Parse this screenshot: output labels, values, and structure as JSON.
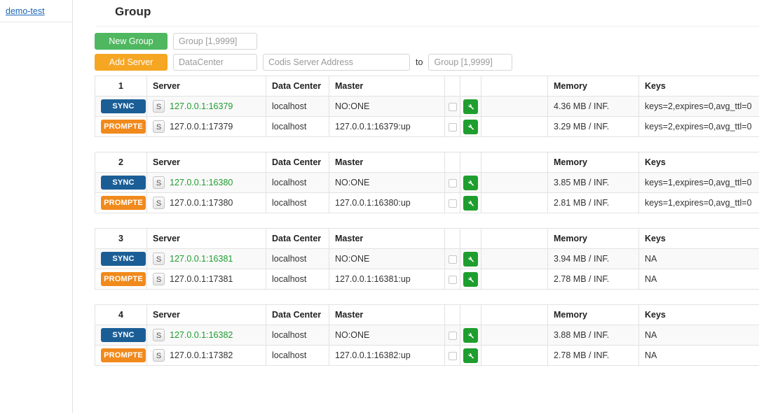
{
  "sidebar": {
    "link_label": "demo-test"
  },
  "header": {
    "title": "Group"
  },
  "toolbar": {
    "new_group_label": "New Group",
    "new_group_placeholder": "Group [1,9999]",
    "new_group_value": "",
    "add_server_label": "Add Server",
    "datacenter_placeholder": "DataCenter",
    "datacenter_value": "",
    "server_address_placeholder": "Codis Server Address",
    "server_address_value": "",
    "to_label": "to",
    "to_group_placeholder": "Group [1,9999]",
    "to_group_value": ""
  },
  "table": {
    "columns": {
      "server": "Server",
      "data_center": "Data Center",
      "master": "Master",
      "memory": "Memory",
      "keys": "Keys"
    },
    "icons": {
      "action": "wrench-icon",
      "select": "checkbox-icon",
      "slave_tag": "S"
    }
  },
  "groups": [
    {
      "id": "1",
      "servers": [
        {
          "role_label": "SYNC",
          "role_kind": "sync",
          "tag": "S",
          "address": "127.0.0.1:16379",
          "is_master": true,
          "data_center": "localhost",
          "master": "NO:ONE",
          "memory": "4.36 MB / INF.",
          "keys": "keys=2,expires=0,avg_ttl=0"
        },
        {
          "role_label": "PROMPTE",
          "role_kind": "prompte",
          "tag": "S",
          "address": "127.0.0.1:17379",
          "is_master": false,
          "data_center": "localhost",
          "master": "127.0.0.1:16379:up",
          "memory": "3.29 MB / INF.",
          "keys": "keys=2,expires=0,avg_ttl=0"
        }
      ]
    },
    {
      "id": "2",
      "servers": [
        {
          "role_label": "SYNC",
          "role_kind": "sync",
          "tag": "S",
          "address": "127.0.0.1:16380",
          "is_master": true,
          "data_center": "localhost",
          "master": "NO:ONE",
          "memory": "3.85 MB / INF.",
          "keys": "keys=1,expires=0,avg_ttl=0"
        },
        {
          "role_label": "PROMPTE",
          "role_kind": "prompte",
          "tag": "S",
          "address": "127.0.0.1:17380",
          "is_master": false,
          "data_center": "localhost",
          "master": "127.0.0.1:16380:up",
          "memory": "2.81 MB / INF.",
          "keys": "keys=1,expires=0,avg_ttl=0"
        }
      ]
    },
    {
      "id": "3",
      "servers": [
        {
          "role_label": "SYNC",
          "role_kind": "sync",
          "tag": "S",
          "address": "127.0.0.1:16381",
          "is_master": true,
          "data_center": "localhost",
          "master": "NO:ONE",
          "memory": "3.94 MB / INF.",
          "keys": "NA"
        },
        {
          "role_label": "PROMPTE",
          "role_kind": "prompte",
          "tag": "S",
          "address": "127.0.0.1:17381",
          "is_master": false,
          "data_center": "localhost",
          "master": "127.0.0.1:16381:up",
          "memory": "2.78 MB / INF.",
          "keys": "NA"
        }
      ]
    },
    {
      "id": "4",
      "servers": [
        {
          "role_label": "SYNC",
          "role_kind": "sync",
          "tag": "S",
          "address": "127.0.0.1:16382",
          "is_master": true,
          "data_center": "localhost",
          "master": "NO:ONE",
          "memory": "3.88 MB / INF.",
          "keys": "NA"
        },
        {
          "role_label": "PROMPTE",
          "role_kind": "prompte",
          "tag": "S",
          "address": "127.0.0.1:17382",
          "is_master": false,
          "data_center": "localhost",
          "master": "127.0.0.1:16382:up",
          "memory": "2.78 MB / INF.",
          "keys": "NA"
        }
      ]
    }
  ],
  "colors": {
    "new_group_button": "#4fb75f",
    "add_server_button": "#f5a623",
    "sync_badge": "#1b5e96",
    "prompte_badge": "#f08a1c",
    "action_button": "#1e9e2e",
    "master_address": "#1f9d2f",
    "sidebar_link": "#1b66b5"
  }
}
